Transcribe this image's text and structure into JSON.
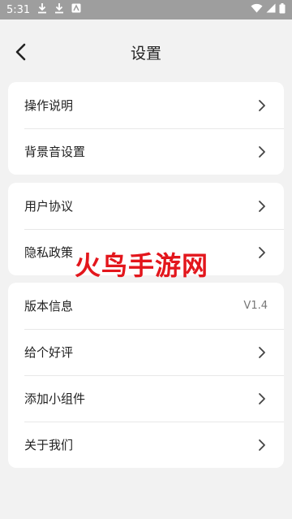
{
  "status_bar": {
    "time": "5:31",
    "left_icons": [
      "download-icon",
      "download-icon",
      "app-badge-icon"
    ],
    "right_icons": [
      "wifi-icon",
      "signal-icon",
      "battery-icon"
    ]
  },
  "header": {
    "title": "设置",
    "back_icon": "back-arrow-icon"
  },
  "groups": [
    {
      "items": [
        {
          "label": "操作说明"
        },
        {
          "label": "背景音设置"
        }
      ]
    },
    {
      "items": [
        {
          "label": "用户协议"
        },
        {
          "label": "隐私政策"
        }
      ]
    },
    {
      "items": [
        {
          "label": "版本信息",
          "value": "V1.4"
        },
        {
          "label": "给个好评"
        },
        {
          "label": "添加小组件"
        },
        {
          "label": "关于我们"
        }
      ]
    }
  ],
  "watermark": "火鸟手游网",
  "colors": {
    "background": "#f2f2f2",
    "card": "#ffffff",
    "status_bar": "#9e9e9e",
    "watermark": "#e3161c"
  }
}
